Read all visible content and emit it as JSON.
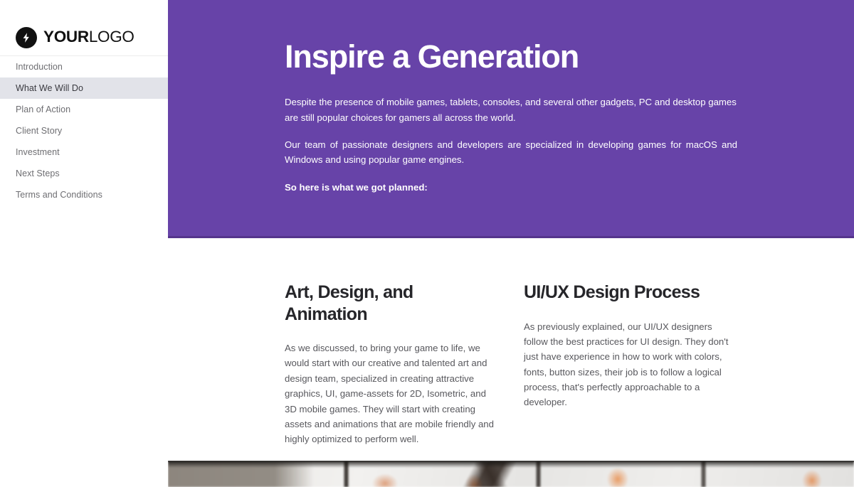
{
  "sidebar": {
    "logo": {
      "icon": "lightning-bolt-icon",
      "bold_part": "YOUR",
      "light_part": "LOGO"
    },
    "items": [
      {
        "label": "Introduction",
        "active": false
      },
      {
        "label": "What We Will Do",
        "active": true
      },
      {
        "label": "Plan of Action",
        "active": false
      },
      {
        "label": "Client Story",
        "active": false
      },
      {
        "label": "Investment",
        "active": false
      },
      {
        "label": "Next Steps",
        "active": false
      },
      {
        "label": "Terms and Conditions",
        "active": false
      }
    ]
  },
  "hero": {
    "title": "Inspire a Generation",
    "paragraph_1": "Despite the presence of mobile games, tablets, consoles, and several other gadgets, PC and desktop games are still popular choices for gamers all across the world.",
    "paragraph_2": "Our team of passionate designers and developers are specialized in developing games for macOS and Windows and using popular game engines.",
    "paragraph_3": "So here is what we got planned:",
    "background_color": "#6743a8",
    "text_color": "#ffffff"
  },
  "body": {
    "columns": [
      {
        "title": "Art, Design, and Animation",
        "text": "As we discussed, to bring your game to life, we would start with our creative and talented art and design team, specialized in creating attractive graphics, UI, game-assets for 2D, Isometric, and 3D mobile games. They will start with creating assets and animations that are mobile friendly and highly optimized to perform well."
      },
      {
        "title": "UI/UX Design Process",
        "text": "As previously explained, our UI/UX designers follow the best practices for UI design. They don't just have experience in how to work with colors, fonts, button sizes, their job is to follow a logical process, that's perfectly approachable to a developer."
      }
    ]
  },
  "photo_strip": {
    "description": "office-interior-photo"
  },
  "colors": {
    "brand_purple": "#6743a8",
    "purple_border": "#55348c",
    "sidebar_active_bg": "#e2e3e9",
    "sidebar_text": "#6e6e72",
    "heading_text": "#26262a",
    "body_text": "#58585d"
  }
}
